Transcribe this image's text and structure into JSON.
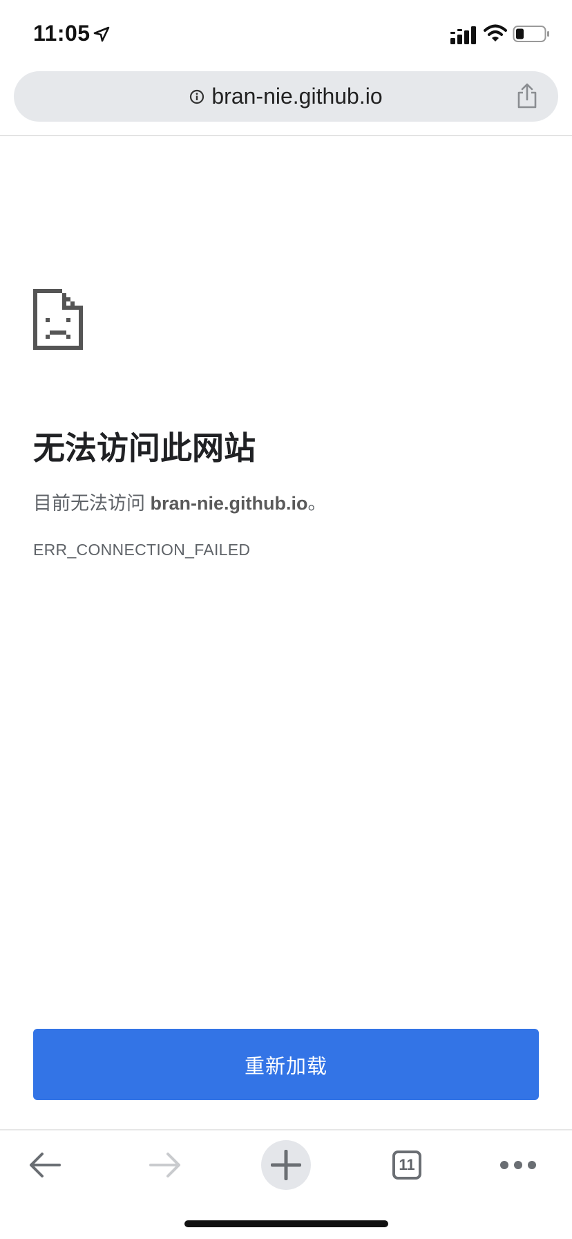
{
  "status_bar": {
    "time": "11:05",
    "icons": [
      "location-arrow-icon",
      "cellular-signal-icon",
      "wifi-icon",
      "battery-icon"
    ]
  },
  "address_bar": {
    "url": "bran-nie.github.io",
    "info_icon": "info-icon",
    "share_icon": "share-icon"
  },
  "error": {
    "icon": "sad-page-icon",
    "title": "无法访问此网站",
    "message_prefix": "目前无法访问 ",
    "message_host": "bran-nie.github.io",
    "message_suffix": "。",
    "code": "ERR_CONNECTION_FAILED"
  },
  "reload_button": {
    "label": "重新加载",
    "color": "#3374e6"
  },
  "toolbar": {
    "back_icon": "back-arrow-icon",
    "forward_icon": "forward-arrow-icon",
    "new_tab_icon": "plus-icon",
    "tab_count": "11",
    "menu_icon": "more-dots-icon"
  }
}
